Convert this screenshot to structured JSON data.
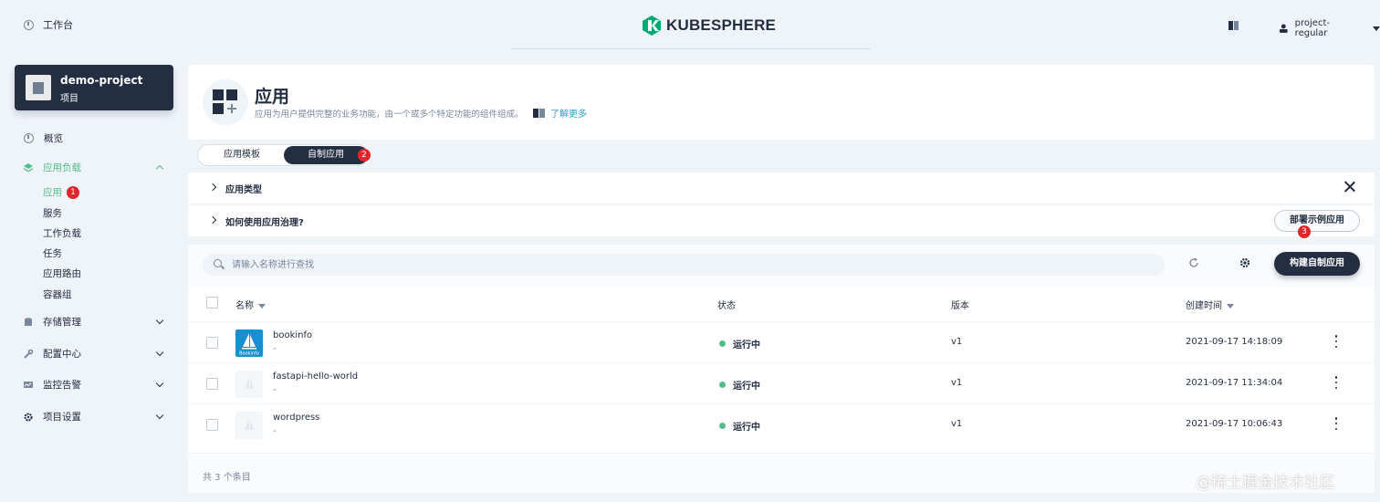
{
  "topbar": {
    "workbench_label": "工作台",
    "logo_text": "KUBESPHERE",
    "username": "project-regular"
  },
  "project": {
    "name": "demo-project",
    "type": "项目"
  },
  "sidebar": {
    "overview": "概览",
    "workloads_group": "应用负载",
    "sub_items": [
      {
        "label": "应用",
        "badge": "1"
      },
      {
        "label": "服务"
      },
      {
        "label": "工作负载"
      },
      {
        "label": "任务"
      },
      {
        "label": "应用路由"
      },
      {
        "label": "容器组"
      }
    ],
    "storage": "存储管理",
    "config": "配置中心",
    "monitoring": "监控告警",
    "settings": "项目设置"
  },
  "header": {
    "title": "应用",
    "description": "应用为用户提供完整的业务功能，由一个或多个特定功能的组件组成。",
    "learn_more": "了解更多"
  },
  "tabs": {
    "template": "应用模板",
    "custom": "自制应用",
    "custom_badge": "2"
  },
  "banners": {
    "app_types": "应用类型",
    "governance": "如何使用应用治理?",
    "deploy_sample": "部署示例应用",
    "deploy_badge": "3"
  },
  "toolbar": {
    "search_placeholder": "请输入名称进行查找",
    "create_button": "构建自制应用"
  },
  "table": {
    "columns": {
      "name": "名称",
      "status": "状态",
      "version": "版本",
      "created": "创建时间"
    },
    "rows": [
      {
        "name": "bookinfo",
        "desc": "-",
        "status": "运行中",
        "version": "v1",
        "created": "2021-09-17 14:18:09",
        "thumb_label": "Bookinfo"
      },
      {
        "name": "fastapi-hello-world",
        "desc": "-",
        "status": "运行中",
        "version": "v1",
        "created": "2021-09-17 11:34:04"
      },
      {
        "name": "wordpress",
        "desc": "-",
        "status": "运行中",
        "version": "v1",
        "created": "2021-09-17 10:06:43"
      }
    ],
    "total": "共 3 个条目"
  },
  "watermark": "@稀土掘金技术社区",
  "colors": {
    "primary_dark": "#242e42",
    "accent_green": "#55bc8a",
    "badge_red": "#e0262b",
    "link_blue": "#329dce",
    "background": "#eff4f9"
  }
}
